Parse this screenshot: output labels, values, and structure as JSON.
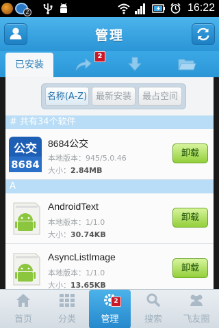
{
  "status_bar": {
    "time": "16:22",
    "notification_badge": "2",
    "icons": [
      "app-notification-icon",
      "user-notification-icon",
      "usb-icon",
      "android-debug-icon",
      "wifi-icon",
      "signal-icon",
      "battery-charging-icon",
      "alarm-icon"
    ]
  },
  "header": {
    "title": "管理",
    "left_icon": "user-icon",
    "right_icon": "refresh-icon"
  },
  "tabs": {
    "installed_label": "已安装",
    "share_badge": "2",
    "icons": [
      "share-arrow-icon",
      "download-icon",
      "folder-icon"
    ]
  },
  "sort": {
    "by_name": "名称(A-Z)",
    "by_recent": "最新安装",
    "by_space": "最占空间",
    "selected": "名称(A-Z)"
  },
  "sections": {
    "count": "# 共有34个软件",
    "letter_a": "A"
  },
  "apps": [
    {
      "name": "8684公交",
      "version": "本地版本：945/5.0.46",
      "size_label": "大小：",
      "size_value": "2.84MB",
      "action": "卸载",
      "icon": "8684-bus-icon"
    },
    {
      "name": "AndroidText",
      "version": "本地版本：1/1.0",
      "size_label": "大小：",
      "size_value": "30.74KB",
      "action": "卸载",
      "icon": "android-app-icon"
    },
    {
      "name": "AsyncListImage",
      "version": "本地版本：1/1.0",
      "size_label": "大小：",
      "size_value": "13.65KB",
      "action": "卸载",
      "icon": "android-app-icon"
    }
  ],
  "bottom_nav": {
    "items": [
      {
        "label": "首页",
        "icon": "home-icon"
      },
      {
        "label": "分类",
        "icon": "grid-icon"
      },
      {
        "label": "管理",
        "icon": "gear-icon",
        "badge": "2"
      },
      {
        "label": "搜索",
        "icon": "search-icon"
      },
      {
        "label": "飞友圈",
        "icon": "friends-icon"
      }
    ],
    "active": "管理"
  },
  "colors": {
    "header_blue": "#2a95d6",
    "section_blue": "#b9ddf6",
    "uninstall_green": "#93cf3b",
    "badge_red": "#c8182a"
  }
}
